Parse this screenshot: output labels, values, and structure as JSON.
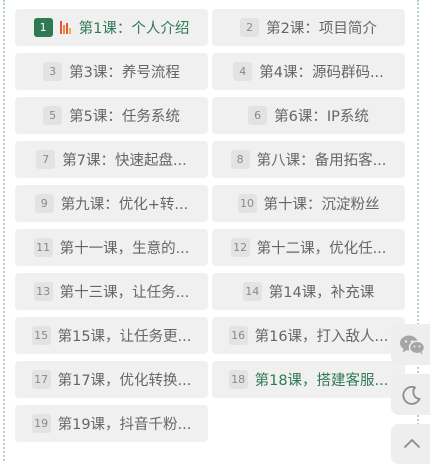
{
  "lessons": [
    {
      "num": "1",
      "title": "第1课：个人介绍",
      "state": "playing"
    },
    {
      "num": "2",
      "title": "第2课：项目简介"
    },
    {
      "num": "3",
      "title": "第3课：养号流程"
    },
    {
      "num": "4",
      "title": "第4课：源码群码..."
    },
    {
      "num": "5",
      "title": "第5课：任务系统"
    },
    {
      "num": "6",
      "title": "第6课：IP系统"
    },
    {
      "num": "7",
      "title": "第7课：快速起盘..."
    },
    {
      "num": "8",
      "title": "第八课：备用拓客..."
    },
    {
      "num": "9",
      "title": "第九课：优化+转..."
    },
    {
      "num": "10",
      "title": "第十课：沉淀粉丝"
    },
    {
      "num": "11",
      "title": "第十一课，生意的..."
    },
    {
      "num": "12",
      "title": "第十二课，优化任..."
    },
    {
      "num": "13",
      "title": "第十三课，让任务..."
    },
    {
      "num": "14",
      "title": "第14课，补充课"
    },
    {
      "num": "15",
      "title": "第15课，让任务更..."
    },
    {
      "num": "16",
      "title": "第16课，打入敌人..."
    },
    {
      "num": "17",
      "title": "第17课，优化转换..."
    },
    {
      "num": "18",
      "title": "第18课，搭建客服...",
      "state": "highlighted"
    },
    {
      "num": "19",
      "title": "第19课，抖音千粉..."
    }
  ],
  "colors": {
    "accent": "#2f7a55",
    "equalizer": [
      "#e5533c",
      "#f08c3a",
      "#e5533c",
      "#f2b233"
    ]
  },
  "icons": {
    "playing": "equalizer-bars-icon",
    "wechat": "wechat-icon",
    "dark_mode": "moon-icon",
    "back_to_top": "chevron-up-icon"
  }
}
